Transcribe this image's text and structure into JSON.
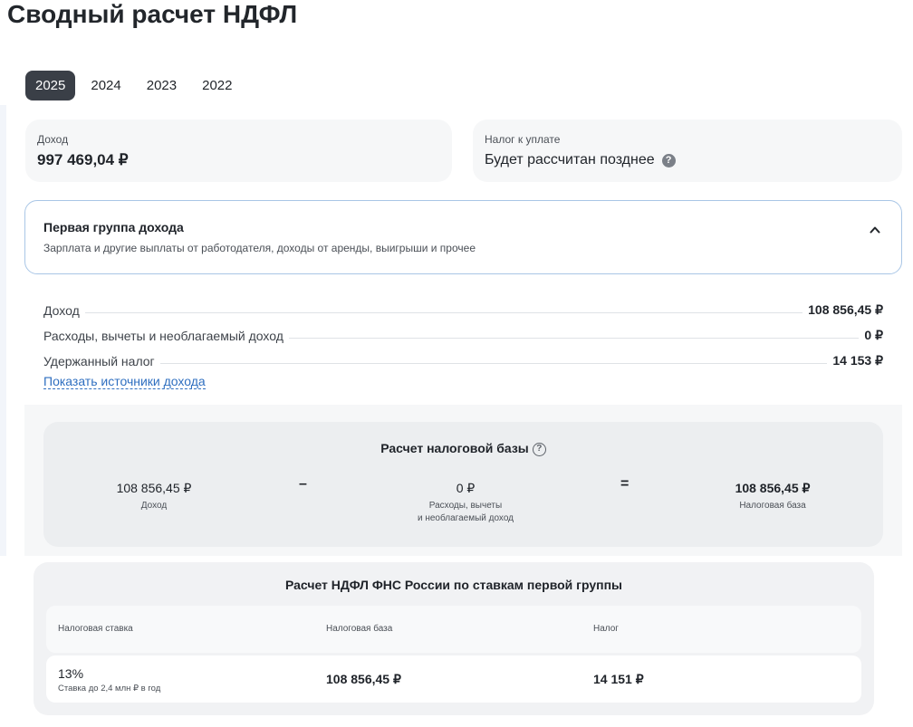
{
  "page": {
    "title": "Сводный расчет НДФЛ"
  },
  "years": [
    "2025",
    "2024",
    "2023",
    "2022"
  ],
  "active_year": "2025",
  "summary": {
    "income_label": "Доход",
    "income_value": "997 469,04 ₽",
    "tax_label": "Налог к уплате",
    "tax_value": "Будет рассчитан позднее"
  },
  "group": {
    "title": "Первая группа дохода",
    "subtitle": "Зарплата и другие выплаты от работодателя, доходы от аренды, выигрыши и прочее",
    "rows": [
      {
        "label": "Доход",
        "value": "108 856,45 ₽"
      },
      {
        "label": "Расходы, вычеты и необлагаемый доход",
        "value": "0 ₽"
      },
      {
        "label": "Удержанный налог",
        "value": "14 153 ₽"
      }
    ],
    "sources_link": "Показать источники дохода"
  },
  "tax_base": {
    "title": "Расчет налоговой базы",
    "income_value": "108 856,45 ₽",
    "income_label": "Доход",
    "minus": "–",
    "deductions_value": "0 ₽",
    "deductions_label_1": "Расходы, вычеты",
    "deductions_label_2": "и необлагаемый доход",
    "equals": "=",
    "base_value": "108 856,45 ₽",
    "base_label": "Налоговая база"
  },
  "rates": {
    "title": "Расчет НДФЛ ФНС России по ставкам первой группы",
    "columns": [
      "Налоговая ставка",
      "Налоговая база",
      "Налог"
    ],
    "rows": [
      {
        "rate": "13%",
        "rate_note": "Ставка до 2,4 млн ₽ в год",
        "base": "108 856,45 ₽",
        "tax": "14 151 ₽"
      }
    ]
  },
  "colors": {
    "active_tab": "#3a3f47",
    "link": "#2f6fc0",
    "panel_border": "#a9c6e6",
    "card_bg": "#f6f7f8"
  }
}
